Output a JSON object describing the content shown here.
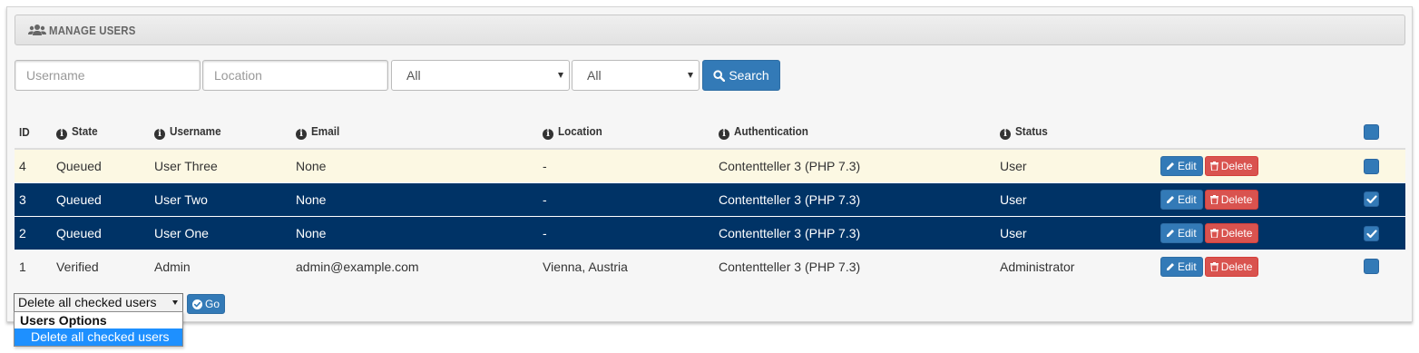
{
  "header": {
    "title": "MANAGE USERS",
    "icon": "users-icon"
  },
  "filters": {
    "username_placeholder": "Username",
    "location_placeholder": "Location",
    "select1_value": "All",
    "select2_value": "All",
    "search_label": "Search"
  },
  "table": {
    "columns": {
      "id": "ID",
      "state": "State",
      "username": "Username",
      "email": "Email",
      "location": "Location",
      "authentication": "Authentication",
      "status": "Status"
    },
    "rows": [
      {
        "id": "4",
        "state": "Queued",
        "username": "User Three",
        "email": "None",
        "location": "-",
        "authentication": "Contentteller 3 (PHP 7.3)",
        "status": "User",
        "checked": false
      },
      {
        "id": "3",
        "state": "Queued",
        "username": "User Two",
        "email": "None",
        "location": "-",
        "authentication": "Contentteller 3 (PHP 7.3)",
        "status": "User",
        "checked": true
      },
      {
        "id": "2",
        "state": "Queued",
        "username": "User One",
        "email": "None",
        "location": "-",
        "authentication": "Contentteller 3 (PHP 7.3)",
        "status": "User",
        "checked": true
      },
      {
        "id": "1",
        "state": "Verified",
        "username": "Admin",
        "email": "admin@example.com",
        "location": "Vienna, Austria",
        "authentication": "Contentteller 3 (PHP 7.3)",
        "status": "Administrator",
        "checked": false
      }
    ],
    "edit_label": "Edit",
    "delete_label": "Delete"
  },
  "bulk": {
    "selected": "Delete all checked users",
    "go_label": "Go",
    "group_label": "Users Options",
    "option": "Delete all checked users"
  },
  "colors": {
    "primary": "#337ab7",
    "danger": "#d9534f",
    "selected_row": "#003366",
    "highlight_row": "#fcf8e3",
    "dropdown_highlight": "#1e90ff"
  }
}
